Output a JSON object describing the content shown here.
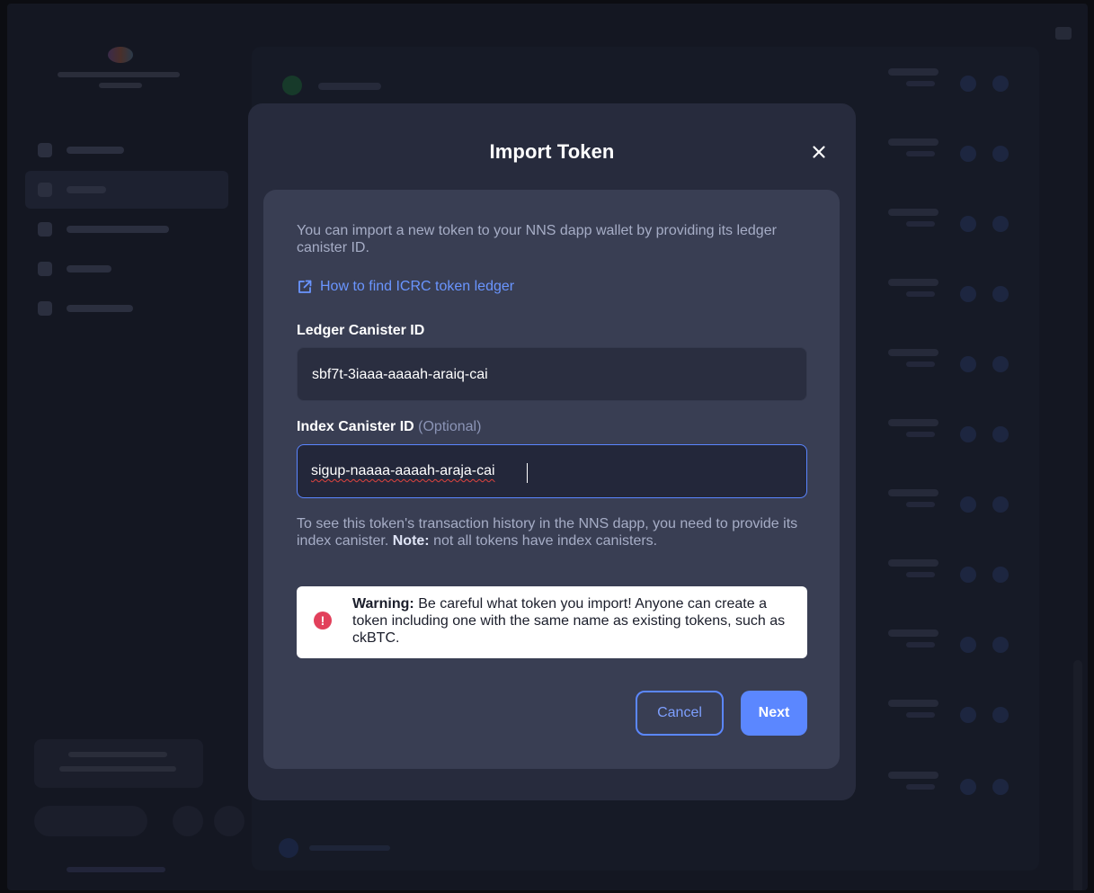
{
  "modal": {
    "title": "Import Token",
    "close_icon": "close-icon",
    "intro": "You can import a new token to your NNS dapp wallet by providing its ledger canister ID.",
    "help_link": "How to find ICRC token ledger",
    "help_link_icon": "external-link-icon",
    "ledger_label": "Ledger Canister ID",
    "ledger_value": "sbf7t-3iaaa-aaaah-araiq-cai",
    "index_label": "Index Canister ID",
    "index_optional": "(Optional)",
    "index_value": "sigup-naaaa-aaaah-araja-cai",
    "hint_before": "To see this token's transaction history in the NNS dapp, you need to provide its index canister.",
    "hint_note": "Note:",
    "hint_after": "not all tokens have index canisters.",
    "warning_bold": "Warning:",
    "warning_text": "Be careful what token you import! Anyone can create a token including one with the same name as existing tokens, such as ckBTC.",
    "warning_icon": "exclamation-icon",
    "cancel_label": "Cancel",
    "next_label": "Next"
  },
  "colors": {
    "accent": "#5b87ff",
    "link": "#6a95ff",
    "warning_icon": "#e2405b",
    "modal_bg": "#272b3d",
    "card_bg": "#393e53"
  }
}
